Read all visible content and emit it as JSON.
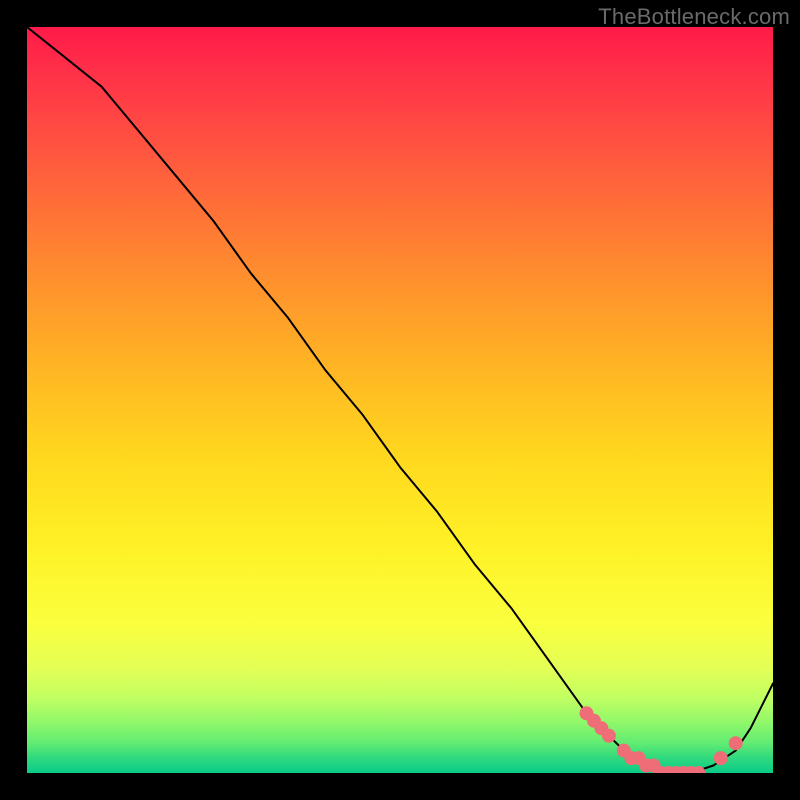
{
  "watermark": "TheBottleneck.com",
  "colors": {
    "frame_bg": "#000000",
    "watermark": "#6a6a6a",
    "gradient_top": "#ff1a49",
    "gradient_mid": "#fff227",
    "gradient_bottom": "#0acb88",
    "curve": "#000000",
    "marker": "#ef6d76"
  },
  "chart_data": {
    "type": "line",
    "title": "",
    "xlabel": "",
    "ylabel": "",
    "xlim": [
      0,
      100
    ],
    "ylim": [
      0,
      100
    ],
    "series": [
      {
        "name": "bottleneck-curve",
        "x": [
          0,
          5,
          10,
          15,
          20,
          25,
          30,
          35,
          40,
          45,
          50,
          55,
          60,
          65,
          70,
          75,
          78,
          80,
          83,
          86,
          89,
          92,
          95,
          97,
          100
        ],
        "y": [
          100,
          96,
          92,
          86,
          80,
          74,
          67,
          61,
          54,
          48,
          41,
          35,
          28,
          22,
          15,
          8,
          5,
          3,
          1,
          0,
          0,
          1,
          3,
          6,
          12
        ]
      }
    ],
    "markers": {
      "name": "highlighted-points",
      "x": [
        75,
        76,
        77,
        78,
        80,
        81,
        82,
        83,
        84,
        85,
        86,
        87,
        88,
        89,
        90,
        93,
        95
      ],
      "y": [
        8,
        7,
        6,
        5,
        3,
        2,
        2,
        1,
        1,
        0,
        0,
        0,
        0,
        0,
        0,
        2,
        4
      ]
    }
  }
}
